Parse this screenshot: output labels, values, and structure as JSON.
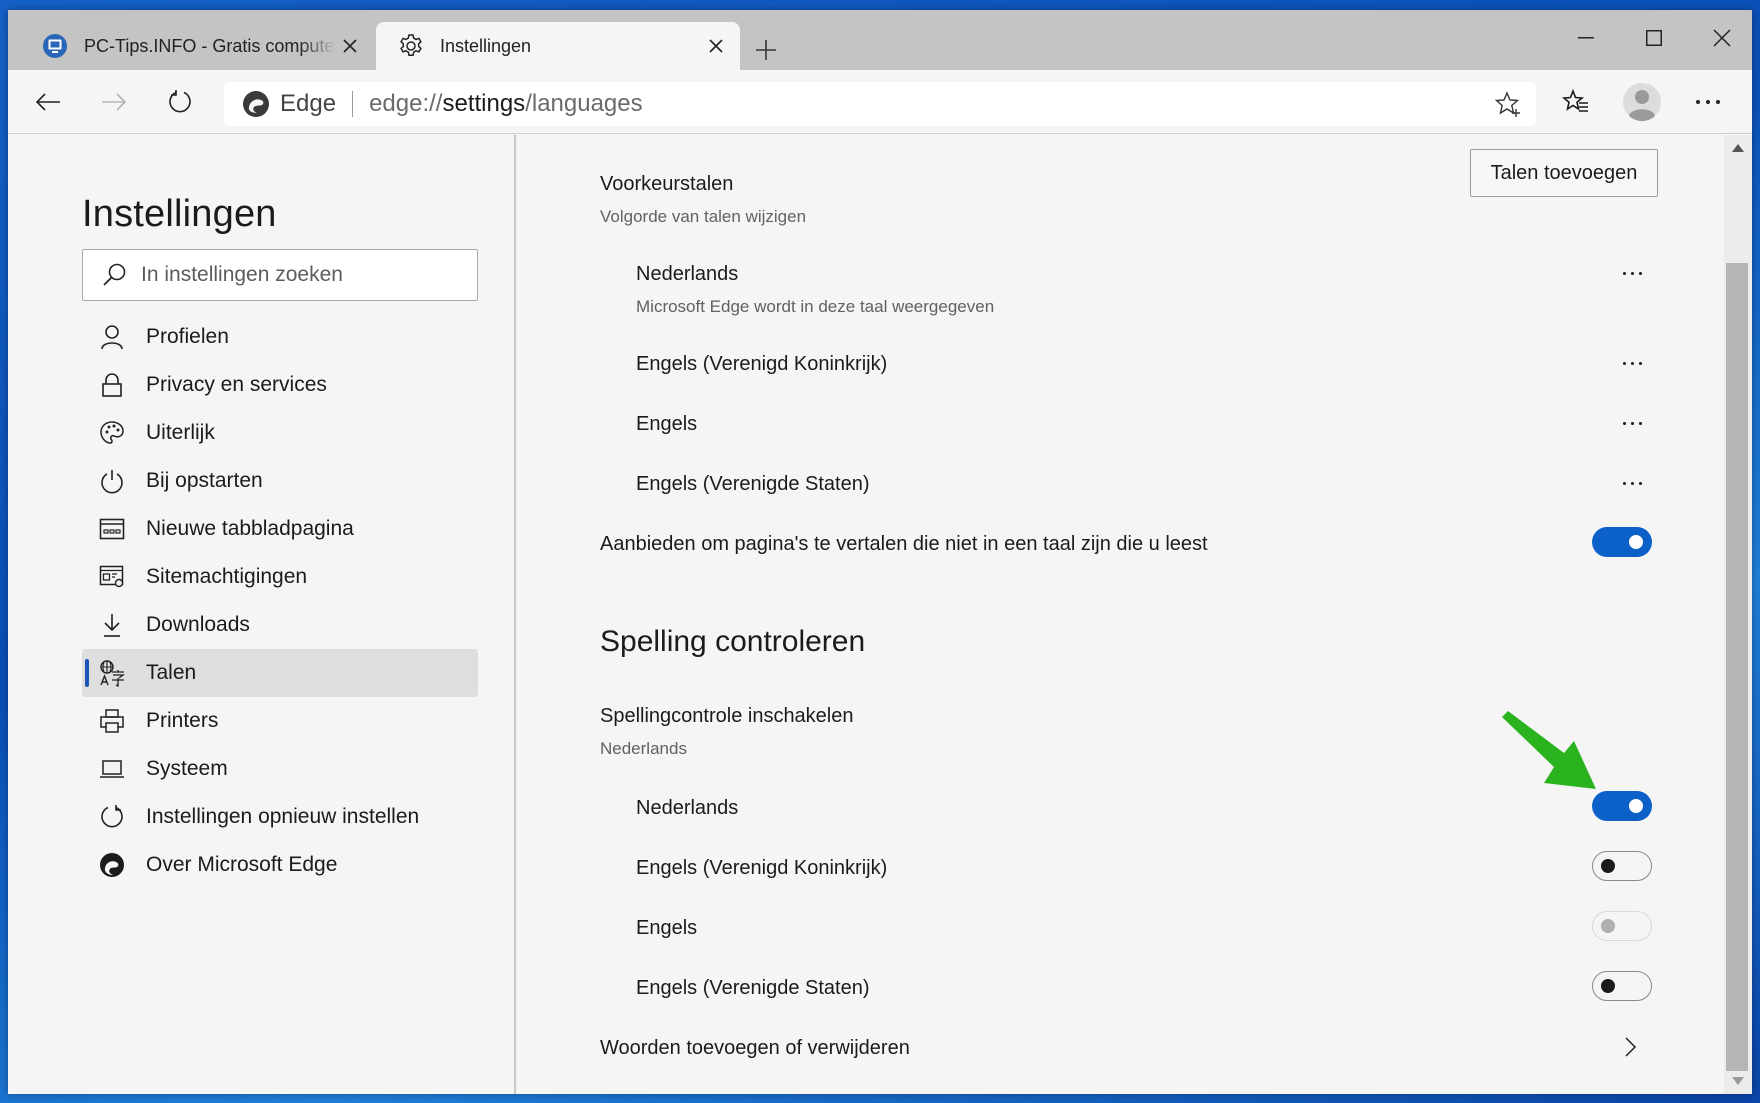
{
  "browser": {
    "tabs": [
      {
        "title": "PC-Tips.INFO - Gratis computer tips",
        "favicon": "pc-tips-favicon",
        "active": false
      },
      {
        "title": "Instellingen",
        "favicon": "gear-icon",
        "active": true
      }
    ],
    "new_tab_label": "+",
    "window_controls": [
      "minimize",
      "maximize",
      "close"
    ],
    "address": {
      "site_label": "Edge",
      "url_prefix": "edge://",
      "url_host": "settings",
      "url_path": "/languages"
    }
  },
  "sidebar": {
    "title": "Instellingen",
    "search_placeholder": "In instellingen zoeken",
    "items": [
      {
        "label": "Profielen",
        "icon": "person-icon"
      },
      {
        "label": "Privacy en services",
        "icon": "lock-icon"
      },
      {
        "label": "Uiterlijk",
        "icon": "palette-icon"
      },
      {
        "label": "Bij opstarten",
        "icon": "power-icon"
      },
      {
        "label": "Nieuwe tabbladpagina",
        "icon": "new-tab-page-icon"
      },
      {
        "label": "Sitemachtigingen",
        "icon": "site-permissions-icon"
      },
      {
        "label": "Downloads",
        "icon": "download-icon"
      },
      {
        "label": "Talen",
        "icon": "languages-icon",
        "selected": true
      },
      {
        "label": "Printers",
        "icon": "printer-icon"
      },
      {
        "label": "Systeem",
        "icon": "laptop-icon"
      },
      {
        "label": "Instellingen opnieuw instellen",
        "icon": "reset-icon"
      },
      {
        "label": "Over Microsoft Edge",
        "icon": "edge-logo-icon"
      }
    ]
  },
  "preferred_languages": {
    "title": "Voorkeurstalen",
    "subtitle": "Volgorde van talen wijzigen",
    "add_button": "Talen toevoegen",
    "languages": [
      {
        "name": "Nederlands",
        "note": "Microsoft Edge wordt in deze taal weergegeven"
      },
      {
        "name": "Engels (Verenigd Koninkrijk)"
      },
      {
        "name": "Engels"
      },
      {
        "name": "Engels (Verenigde Staten)"
      }
    ],
    "offer_translate": {
      "label": "Aanbieden om pagina's te vertalen die niet in een taal zijn die u leest",
      "enabled": true
    }
  },
  "spellcheck": {
    "section_title": "Spelling controleren",
    "enable_label": "Spellingcontrole inschakelen",
    "enable_sub": "Nederlands",
    "languages": [
      {
        "name": "Nederlands",
        "state": "on"
      },
      {
        "name": "Engels (Verenigd Koninkrijk)",
        "state": "off"
      },
      {
        "name": "Engels",
        "state": "disabled"
      },
      {
        "name": "Engels (Verenigde Staten)",
        "state": "off"
      }
    ],
    "custom_words_label": "Woorden toevoegen of verwijderen"
  },
  "colors": {
    "accent": "#0c61c9",
    "annotation_arrow": "#2bb21f",
    "selected_indicator": "#1a56b8"
  }
}
